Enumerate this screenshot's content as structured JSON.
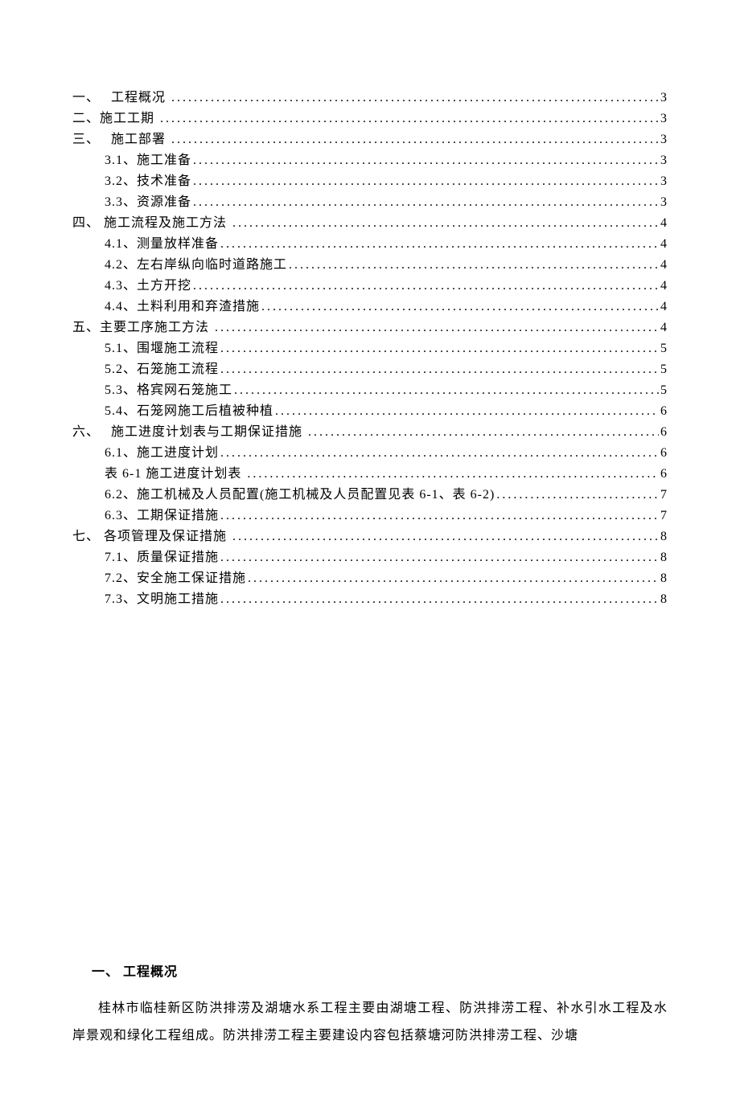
{
  "toc": [
    {
      "level": 1,
      "label": "一、　 工程概况 ",
      "page": "3"
    },
    {
      "level": 1,
      "label": "二、施工工期 ",
      "page": "3"
    },
    {
      "level": 1,
      "label": "三、　 施工部署 ",
      "page": "3"
    },
    {
      "level": 2,
      "label": "3.1、施工准备",
      "page": "3"
    },
    {
      "level": 2,
      "label": "3.2、技术准备",
      "page": "3"
    },
    {
      "level": 2,
      "label": "3.3、资源准备",
      "page": "3"
    },
    {
      "level": 1,
      "label": "四、 施工流程及施工方法 ",
      "page": "4"
    },
    {
      "level": 2,
      "label": "4.1、测量放样准备",
      "page": "4"
    },
    {
      "level": 2,
      "label": "4.2、左右岸纵向临时道路施工",
      "page": "4"
    },
    {
      "level": 2,
      "label": "4.3、土方开挖",
      "page": "4"
    },
    {
      "level": 2,
      "label": "4.4、土料利用和弃渣措施",
      "page": "4"
    },
    {
      "level": 1,
      "label": "五、主要工序施工方法 ",
      "page": "4"
    },
    {
      "level": 2,
      "label": "5.1、围堰施工流程",
      "page": "5"
    },
    {
      "level": 2,
      "label": "5.2、石笼施工流程",
      "page": "5"
    },
    {
      "level": 2,
      "label": "5.3、格宾网石笼施工",
      "page": "5"
    },
    {
      "level": 2,
      "label": "5.4、石笼网施工后植被种植",
      "page": "6"
    },
    {
      "level": 1,
      "label": "六、　 施工进度计划表与工期保证措施 ",
      "page": "6"
    },
    {
      "level": 2,
      "label": "6.1、施工进度计划",
      "page": "6"
    },
    {
      "level": 2,
      "label": "表 6-1 施工进度计划表 ",
      "page": "6"
    },
    {
      "level": 2,
      "label": "6.2、施工机械及人员配置(施工机械及人员配置见表 6-1、表 6-2)",
      "page": "7"
    },
    {
      "level": 2,
      "label": "6.3、工期保证措施",
      "page": "7"
    },
    {
      "level": 1,
      "label": "七、 各项管理及保证措施 ",
      "page": "8"
    },
    {
      "level": 2,
      "label": "7.1、质量保证措施",
      "page": "8"
    },
    {
      "level": 2,
      "label": "7.2、安全施工保证措施",
      "page": "8"
    },
    {
      "level": 2,
      "label": "7.3、文明施工措施",
      "page": "8"
    }
  ],
  "body": {
    "heading1": "一、 工程概况",
    "para1": "桂林市临桂新区防洪排涝及湖塘水系工程主要由湖塘工程、防洪排涝工程、补水引水工程及水岸景观和绿化工程组成。防洪排涝工程主要建设内容包括蔡塘河防洪排涝工程、沙塘"
  }
}
